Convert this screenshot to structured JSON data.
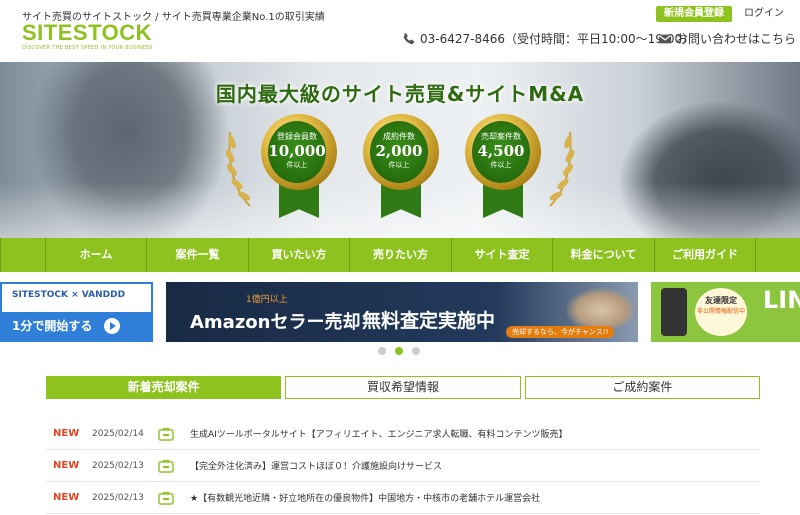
{
  "header": {
    "tagline": "サイト売買のサイトストック / サイト売買専業企業No.1の取引実績",
    "logo": "SITESTOCK",
    "logo_sub": "DISCOVER THE BEST SPEED IN YOUR BUSINESS",
    "register_label": "新規会員登録",
    "login_label": "ログイン",
    "phone": "03-6427-8466（受付時間：平日10:00〜19:00）",
    "contact": "お問い合わせはこちら"
  },
  "hero": {
    "title": "国内最大級のサイト売買&サイトM&A",
    "medals": [
      {
        "label": "登録会員数",
        "value": "10,000",
        "unit": "件以上"
      },
      {
        "label": "成約件数",
        "value": "2,000",
        "unit": "件以上"
      },
      {
        "label": "売却案件数",
        "value": "4,500",
        "unit": "件以上"
      }
    ]
  },
  "nav": {
    "items": [
      "ホーム",
      "案件一覧",
      "買いたい方",
      "売りたい方",
      "サイト査定",
      "料金について",
      "ご利用ガイド"
    ]
  },
  "banners": {
    "b1_top": "SITESTOCK × VANDDD",
    "b1_bottom": "1分で開始する",
    "b2_sub": "1億円以上",
    "b2_main1": "Amazonセラー売却",
    "b2_main2": "無料査定実施中",
    "b2_chance": "売却するなら、今がチャンス!!",
    "b3_badge1": "友達限定",
    "b3_badge2": "非公開情報配信中",
    "b3_text": "LIN"
  },
  "tabs": [
    "新着売却案件",
    "買収希望情報",
    "ご成約案件"
  ],
  "news": [
    {
      "badge": "NEW",
      "date": "2025/02/14",
      "title": "生成AIツールポータルサイト【アフィリエイト、エンジニア求人転職、有料コンテンツ販売】"
    },
    {
      "badge": "NEW",
      "date": "2025/02/13",
      "title": "【完全外注化済み】運営コストほぼ０！介護施設向けサービス"
    },
    {
      "badge": "NEW",
      "date": "2025/02/13",
      "title": "★【有数観光地近隣・好立地所在の優良物件】中国地方・中核市の老舗ホテル運営会社"
    }
  ],
  "colors": {
    "brand": "#8ec31f",
    "new": "#e0451f",
    "medal_gold": "#e7c04a",
    "ribbon": "#2f7a14"
  }
}
